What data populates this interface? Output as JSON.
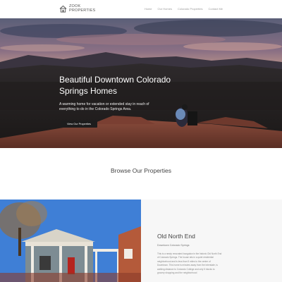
{
  "header": {
    "logo_line1": "ZOOK",
    "logo_line2": "PROPERTIES",
    "nav": [
      "Home",
      "Our Homes",
      "Colorado Properties",
      "Contact Me"
    ]
  },
  "hero": {
    "title": "Beautiful Downtown Colorado Springs Homes",
    "subtitle": "A warming home for vacation or extended stay in reach of everything to do in the Colorado Springs Area.",
    "button_label": "View Our Properties"
  },
  "browse": {
    "title": "Browse Our Properties"
  },
  "property": {
    "name": "Old North End",
    "location": "Downtown Colorado Springs",
    "description": "This is a newly renovated bungalow in the historic Old North End of Colorado Springs. The house sits in a quiet residential neighborhood and is less than 5 miles to the center of Downtown. This home is minutes away from the Interstate, is walking distance to Colorado College and only 5 blocks to grocery shopping and the neighborhood"
  },
  "colors": {
    "button_bg": "#1d1d1d",
    "info_bg": "#f7f7f7",
    "nav_text": "#9a9a9a"
  }
}
